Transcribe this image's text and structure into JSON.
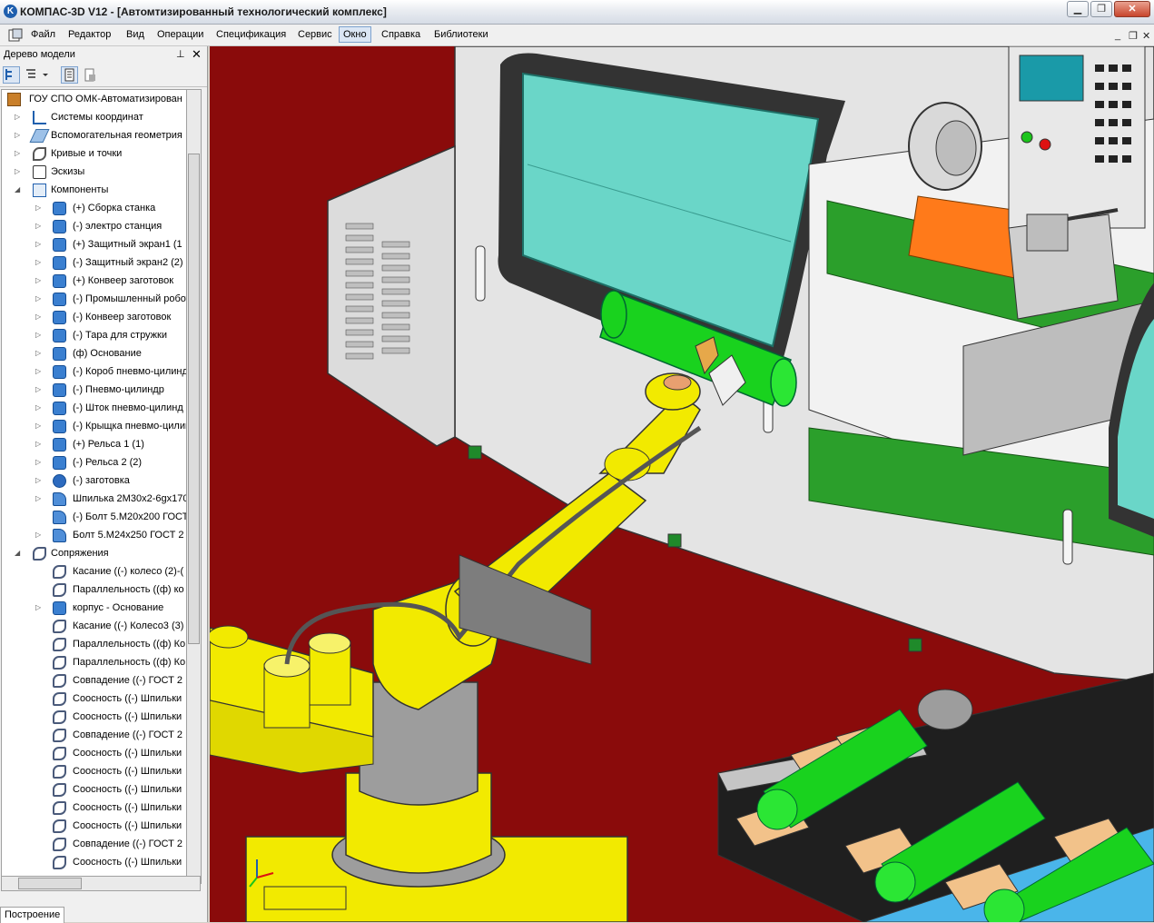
{
  "window": {
    "title": "КОМПАС-3D V12 - [Автомтизированный технологический комплекс]",
    "logo_letter": "K",
    "minimize_label": "▁",
    "restore_label": "❐",
    "close_label": "✕"
  },
  "menu": {
    "items": [
      "Файл",
      "Редактор",
      "Вид",
      "Операции",
      "Спецификация",
      "Сервис",
      "Окно",
      "Справка",
      "Библиотеки"
    ],
    "active_item": "Окно",
    "doc_minimize": "_",
    "doc_restore": "❐",
    "doc_close": "✕"
  },
  "model_tree": {
    "title": "Дерево модели",
    "pin_icon": "pin-icon",
    "close_label": "✕",
    "bottom_tab": "Построение",
    "items": [
      {
        "label": "ГОУ СПО ОМК-Автоматизирован",
        "icon": "assembly-root-icon"
      },
      {
        "label": "Системы координат",
        "icon": "coordinate-systems-icon"
      },
      {
        "label": "Вспомогательная геометрия",
        "icon": "auxiliary-geometry-icon"
      },
      {
        "label": "Кривые и точки",
        "icon": "curves-icon"
      },
      {
        "label": "Эскизы",
        "icon": "sketches-icon"
      },
      {
        "label": "Компоненты",
        "icon": "components-icon"
      },
      {
        "label": "(+) Сборка станка",
        "icon": "component-icon"
      },
      {
        "label": "(-) электро станция",
        "icon": "component-icon"
      },
      {
        "label": "(+) Защитный экран1 (1",
        "icon": "component-icon"
      },
      {
        "label": "(-) Защитный экран2 (2)",
        "icon": "component-icon"
      },
      {
        "label": "(+) Конвеер заготовок",
        "icon": "component-icon"
      },
      {
        "label": "(-) Промышленный робот",
        "icon": "component-icon"
      },
      {
        "label": "(-) Конвеер заготовок",
        "icon": "component-icon"
      },
      {
        "label": "(-) Тара для стружки",
        "icon": "component-icon"
      },
      {
        "label": "(ф) Основание",
        "icon": "component-icon"
      },
      {
        "label": "(-) Короб пневмо-цилинд",
        "icon": "component-icon"
      },
      {
        "label": "(-) Пневмо-цилиндр",
        "icon": "component-icon"
      },
      {
        "label": "(-) Шток пневмо-цилинд",
        "icon": "component-icon"
      },
      {
        "label": "(-) Крыщка пневмо-цилин",
        "icon": "component-icon"
      },
      {
        "label": "(+) Рельса 1 (1)",
        "icon": "component-icon"
      },
      {
        "label": "(-) Рельса 2 (2)",
        "icon": "component-icon"
      },
      {
        "label": "(-) заготовка",
        "icon": "part-icon"
      },
      {
        "label": "Шпилька 2М30х2-6gх170",
        "icon": "bolt-icon"
      },
      {
        "label": "(-) Болт 5.М20х200 ГОСТ",
        "icon": "bolt-icon"
      },
      {
        "label": "Болт 5.М24х250 ГОСТ 2",
        "icon": "bolt-icon"
      },
      {
        "label": "Сопряжения",
        "icon": "mates-icon"
      },
      {
        "label": "Касание ((-) колесо (2)-(",
        "icon": "mate-icon"
      },
      {
        "label": "Параллельность ((ф) ко",
        "icon": "mate-icon"
      },
      {
        "label": "корпус - Основание",
        "icon": "mate-group-icon"
      },
      {
        "label": "Касание ((-) Колесо3 (3)",
        "icon": "mate-icon"
      },
      {
        "label": "Параллельность ((ф) Ко",
        "icon": "mate-icon"
      },
      {
        "label": "Параллельность ((ф) Ко",
        "icon": "mate-icon"
      },
      {
        "label": "Совпадение ((-) ГОСТ 2",
        "icon": "mate-icon"
      },
      {
        "label": "Соосность ((-) Шпильки",
        "icon": "mate-icon"
      },
      {
        "label": "Соосность ((-) Шпильки",
        "icon": "mate-icon"
      },
      {
        "label": "Совпадение ((-) ГОСТ 2",
        "icon": "mate-icon"
      },
      {
        "label": "Соосность ((-) Шпильки",
        "icon": "mate-icon"
      },
      {
        "label": "Соосность ((-) Шпильки",
        "icon": "mate-icon"
      },
      {
        "label": "Соосность ((-) Шпильки",
        "icon": "mate-icon"
      },
      {
        "label": "Соосность ((-) Шпильки",
        "icon": "mate-icon"
      },
      {
        "label": "Соосность ((-) Шпильки",
        "icon": "mate-icon"
      },
      {
        "label": "Совпадение ((-) ГОСТ 2",
        "icon": "mate-icon"
      },
      {
        "label": "Соосность ((-) Шпильки",
        "icon": "mate-icon"
      }
    ]
  },
  "viewport": {
    "description_icon": "3d-scene",
    "colors": {
      "floor": "#8a0b0b",
      "machine_body": "#e6e6e6",
      "robot": "#f2ea00",
      "workpiece": "#19d21e",
      "glass": "#6ad6c8",
      "rail": "#2b9f2b"
    }
  }
}
